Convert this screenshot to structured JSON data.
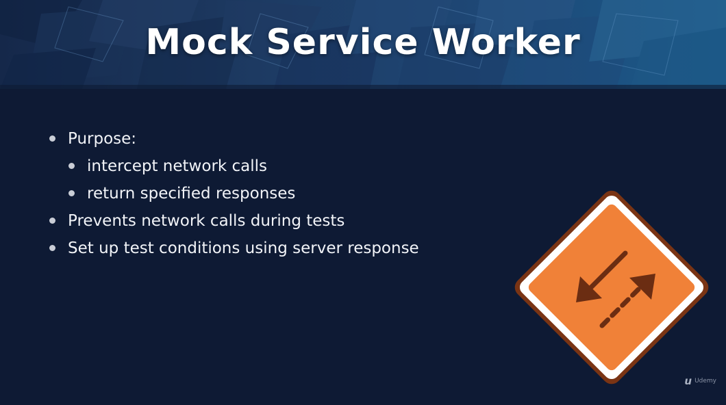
{
  "slide": {
    "title": "Mock Service Worker",
    "bullets": [
      {
        "level": 1,
        "text": "Purpose:"
      },
      {
        "level": 2,
        "text": "intercept network calls"
      },
      {
        "level": 2,
        "text": "return specified responses"
      },
      {
        "level": 1,
        "text": "Prevents network calls during tests"
      },
      {
        "level": 1,
        "text": "Set up test conditions using server response"
      }
    ]
  },
  "watermark": {
    "icon": "udemy-logo-icon",
    "text": "Udemy"
  },
  "sign_icon": "two-way-arrows-diamond-sign-icon",
  "colors": {
    "background": "#0e1a34",
    "sign_fill": "#f08138",
    "sign_arrow": "#6b2d12"
  }
}
